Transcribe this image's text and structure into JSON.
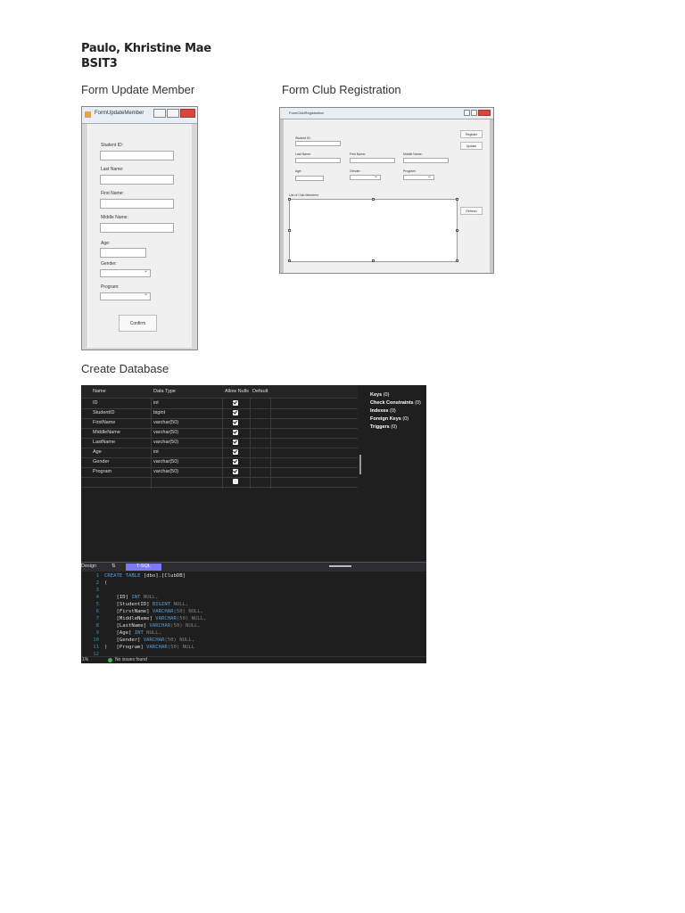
{
  "author": {
    "name": "Paulo, Khristine Mae",
    "section": "BSIT3"
  },
  "headings": {
    "form_update": "Form Update Member",
    "form_club": "Form Club Registration",
    "create_db": "Create Database"
  },
  "form_update": {
    "title": "FormUpdateMember",
    "labels": {
      "student_id": "Student ID:",
      "last_name": "Last Name:",
      "first_name": "First Name:",
      "middle_name": "Middle Name:",
      "age": "Age:",
      "gender": "Gender:",
      "program": "Program:"
    },
    "confirm_label": "Confirm"
  },
  "form_club": {
    "title": "FormClubRegistration",
    "labels": {
      "student_id": "Student ID:",
      "last_name": "Last Name:",
      "first_name": "First Name:",
      "middle_name": "Middle Name:",
      "age": "Age:",
      "gender": "Gender:",
      "program": "Program:",
      "list": "List of Club Members"
    },
    "register_label": "Register",
    "update_label": "Update",
    "refresh_label": "Refresh"
  },
  "database": {
    "columns": {
      "name": "Name",
      "type": "Data Type",
      "nulls": "Allow Nulls",
      "default": "Default"
    },
    "rows": [
      {
        "name": "ID",
        "type": "int"
      },
      {
        "name": "StudentID",
        "type": "bigint"
      },
      {
        "name": "FirstName",
        "type": "varchar(50)"
      },
      {
        "name": "MiddleName",
        "type": "varchar(50)"
      },
      {
        "name": "LastName",
        "type": "varchar(50)"
      },
      {
        "name": "Age",
        "type": "int"
      },
      {
        "name": "Gender",
        "type": "varchar(50)"
      },
      {
        "name": "Program",
        "type": "varchar(50)"
      },
      {
        "name": "",
        "type": ""
      }
    ],
    "side": [
      {
        "label": "Keys",
        "count": "(0)"
      },
      {
        "label": "Check Constraints",
        "count": "(0)"
      },
      {
        "label": "Indexes",
        "count": "(0)"
      },
      {
        "label": "Foreign Keys",
        "count": "(0)"
      },
      {
        "label": "Triggers",
        "count": "(0)"
      }
    ],
    "tabs": {
      "design": "Design",
      "swap": "⇅",
      "tsql": "T-SQL"
    },
    "code": {
      "l1_kw1": "CREATE",
      "l1_kw2": "TABLE",
      "l1_rest": "[dbo].[ClubDB]",
      "l2": "(",
      "cols": [
        {
          "name": "[ID]",
          "type": "INT",
          "tail": " NULL,"
        },
        {
          "name": "[StudentID]",
          "type": "BIGINT",
          "tail": " NULL,"
        },
        {
          "name": "[FirstName]",
          "type": "VARCHAR",
          "tail": "(50) NULL,"
        },
        {
          "name": "[MiddleName]",
          "type": "VARCHAR",
          "tail": "(50) NULL,"
        },
        {
          "name": "[LastName]",
          "type": "VARCHAR",
          "tail": "(50) NULL,"
        },
        {
          "name": "[Age]",
          "type": "INT",
          "tail": " NULL,"
        },
        {
          "name": "[Gender]",
          "type": "VARCHAR",
          "tail": "(50) NULL,"
        },
        {
          "name": "[Program]",
          "type": "VARCHAR",
          "tail": "(50) NULL"
        }
      ],
      "l11": ")",
      "line_numbers": [
        "1",
        "2",
        "3",
        "4",
        "5",
        "6",
        "7",
        "8",
        "9",
        "10",
        "11",
        "12"
      ]
    },
    "status": {
      "zoom": "1%",
      "message": "No issues found"
    }
  }
}
